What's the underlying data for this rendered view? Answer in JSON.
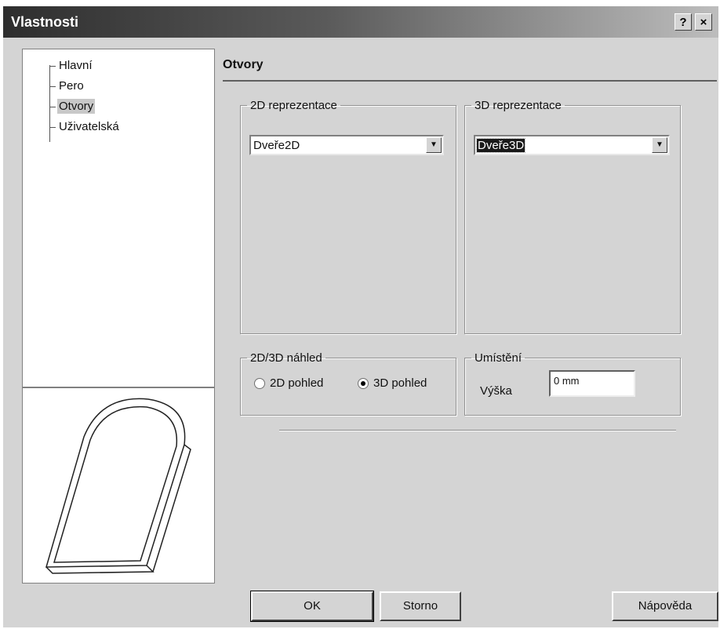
{
  "window": {
    "title": "Vlastnosti",
    "help_label": "?",
    "close_label": "×"
  },
  "tree": {
    "items": [
      {
        "label": "Hlavní",
        "selected": false
      },
      {
        "label": "Pero",
        "selected": false
      },
      {
        "label": "Otvory",
        "selected": true
      },
      {
        "label": "Uživatelská",
        "selected": false
      }
    ]
  },
  "page": {
    "title": "Otvory",
    "group_2d": {
      "legend": "2D reprezentace",
      "value": "Dveře2D"
    },
    "group_3d": {
      "legend": "3D reprezentace",
      "value": "Dveře3D"
    },
    "group_view": {
      "legend": "2D/3D náhled",
      "option_2d": "2D pohled",
      "option_3d": "3D pohled",
      "selected": "3D pohled"
    },
    "group_position": {
      "legend": "Umístění",
      "height_label": "Výška",
      "height_value": "0 mm"
    }
  },
  "buttons": {
    "ok": "OK",
    "cancel": "Storno",
    "help": "Nápověda"
  },
  "icons": {
    "combo_arrow": "chevron-down-icon",
    "help": "question-icon",
    "close": "close-icon"
  }
}
